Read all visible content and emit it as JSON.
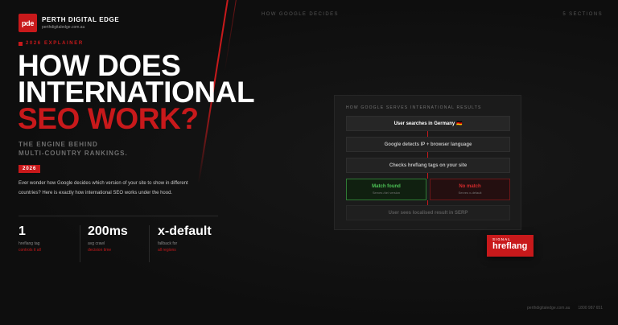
{
  "brand": {
    "logo_text": "pde",
    "name": "PERTH DIGITAL EDGE",
    "url": "perthdigitaledge.com.au"
  },
  "top_bar": {
    "center": "HOW GOOGLE DECIDES",
    "right": "5 SECTIONS"
  },
  "hero": {
    "eyebrow": "2026 EXPLAINER",
    "headline_line1": "HOW DOES",
    "headline_line2": "INTERNATIONAL",
    "headline_line3": "SEO WORK?",
    "subhead_line1": "THE ENGINE BEHIND",
    "subhead_line2": "MULTI-COUNTRY RANKINGS.",
    "year_badge": "2026",
    "description": "Ever wonder how Google decides which version of your site to show in different countries? Here is exactly how international SEO works under the hood."
  },
  "stats": [
    {
      "value": "1",
      "label": "hreflang tag",
      "note": "controls it all"
    },
    {
      "value": "200ms",
      "label": "avg crawl",
      "note": "decision time"
    },
    {
      "value": "x-default",
      "label": "fallback for",
      "note": "all regions"
    }
  ],
  "flow": {
    "title": "HOW GOOGLE SERVES INTERNATIONAL RESULTS",
    "step1": "User searches in Germany 🇩🇪",
    "step2": "Google detects IP + browser language",
    "step3": "Checks hreflang tags on your site",
    "match_title": "Match found",
    "match_sub": "Serves /de/ version",
    "nomatch_title": "No match",
    "nomatch_sub": "Serves x-default",
    "step4": "User sees localised result in SERP"
  },
  "signal": {
    "kicker": "SIGNAL",
    "value": "hreflang"
  },
  "footer": {
    "url": "perthdigitaledge.com.au",
    "phone": "1800 987 651"
  },
  "colors": {
    "accent": "#c8191b",
    "background": "#111111",
    "match": "#4cc255",
    "nomatch": "#d32b2d"
  }
}
